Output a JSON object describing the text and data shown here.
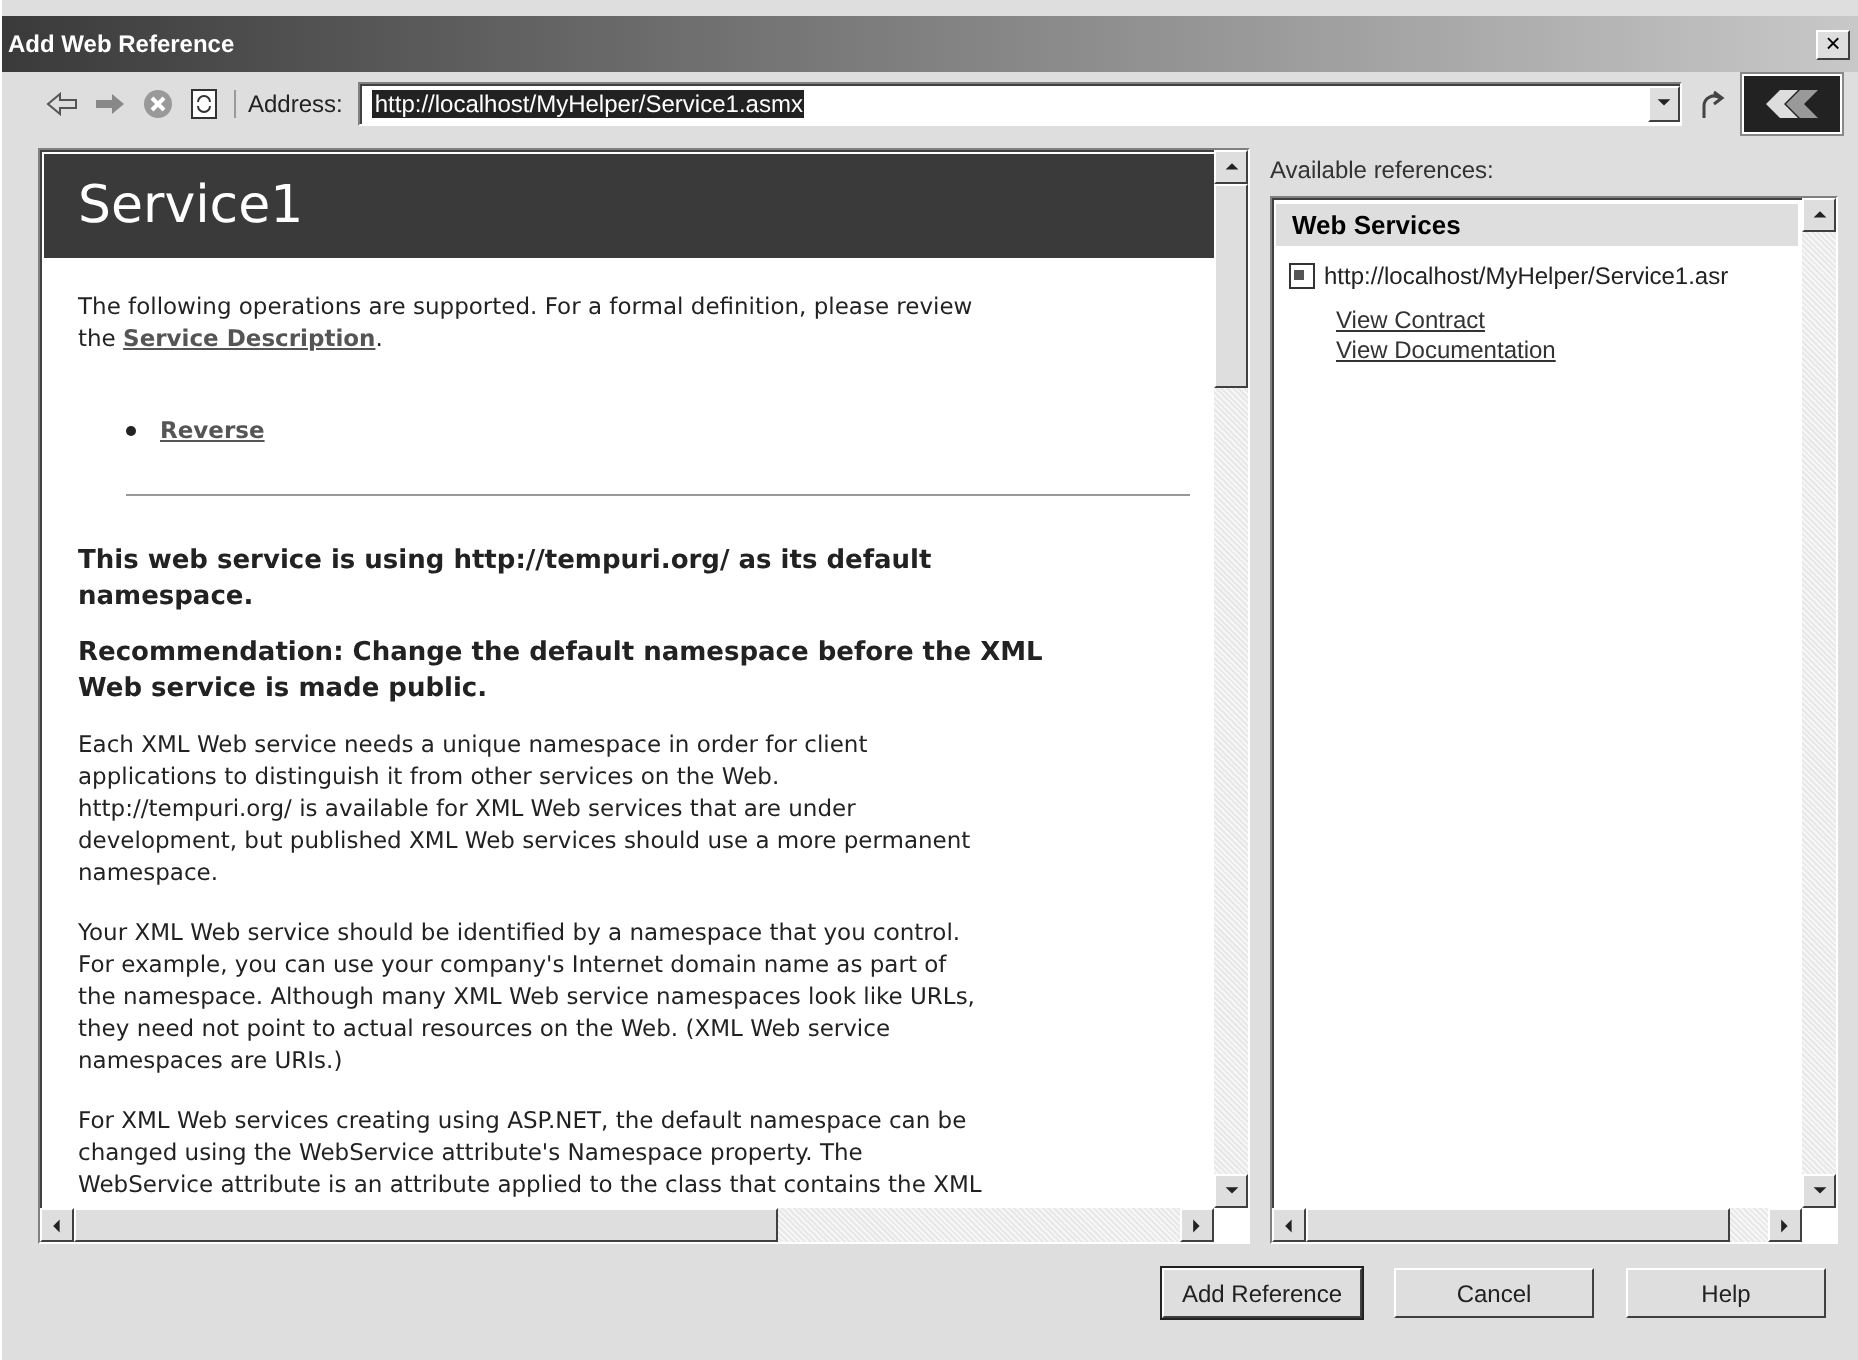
{
  "window": {
    "title": "Add Web Reference",
    "close": "×"
  },
  "toolbar": {
    "address_label": "Address:",
    "address": "http://localhost/MyHelper/Service1.asmx"
  },
  "browser": {
    "heading": "Service1",
    "intro": "The following operations are supported. For a formal definition, please review\nthe ",
    "intro_link": "Service Description",
    "intro_end": ".",
    "operations": [
      "Reverse"
    ],
    "notes": [
      "This web service is using http://tempuri.org/ as its default\nnamespace.",
      "Recommendation: Change the default namespace before the XML\nWeb service is made public."
    ],
    "paragraphs": [
      "Each XML Web service needs a unique namespace in order for client\napplications to distinguish it from other services on the Web.\nhttp://tempuri.org/ is available for XML Web services that are under\ndevelopment, but published XML Web services should use a more permanent\nnamespace.",
      "Your XML Web service should be identified by a namespace that you control.\nFor example, you can use your company's Internet domain name as part of\nthe namespace. Although many XML Web service namespaces look like URLs,\nthey need not point to actual resources on the Web. (XML Web service\nnamespaces are URIs.)",
      "For XML Web services creating using ASP.NET, the default namespace can be\nchanged using the WebService attribute's Namespace property. The\nWebService attribute is an attribute applied to the class that contains the XML"
    ]
  },
  "references": {
    "label": "Available references:",
    "group": "Web Services",
    "items": [
      {
        "url": "http://localhost/MyHelper/Service1.asr",
        "links": [
          "View Contract",
          "View Documentation"
        ]
      }
    ]
  },
  "buttons": [
    "Add Reference",
    "Cancel",
    "Help"
  ]
}
